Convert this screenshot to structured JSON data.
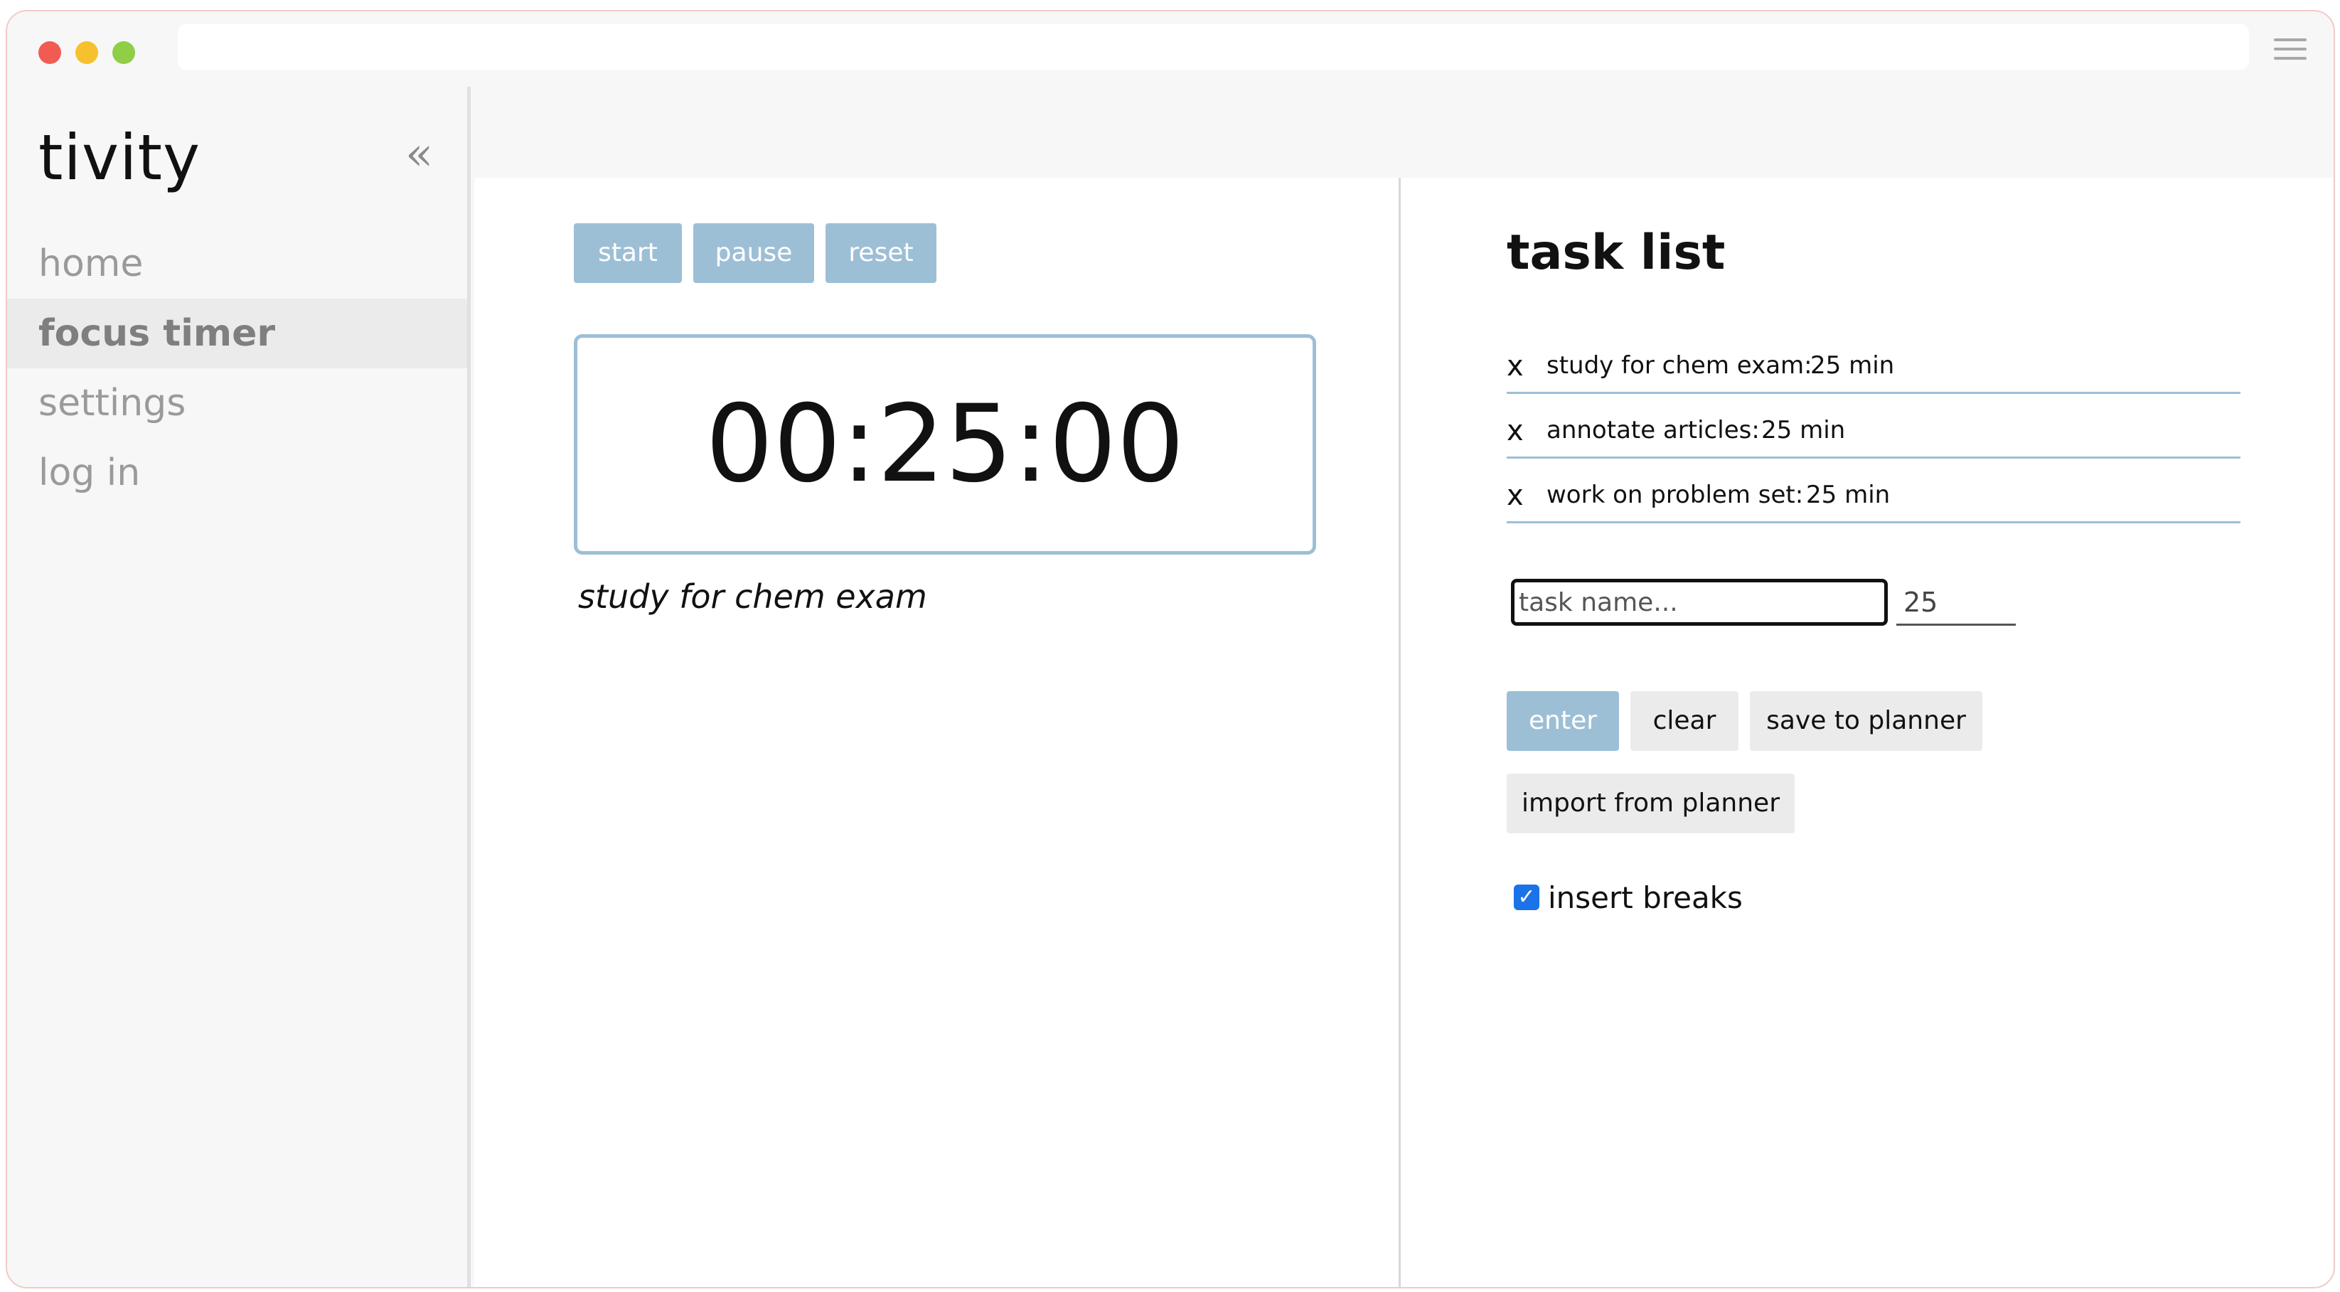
{
  "brand": {
    "title": "tivity",
    "collapse_symbol": "«"
  },
  "sidebar": {
    "items": [
      {
        "label": "home"
      },
      {
        "label": "focus timer",
        "active": true
      },
      {
        "label": "settings"
      },
      {
        "label": "log in"
      }
    ]
  },
  "timer": {
    "controls": {
      "start": "start",
      "pause": "pause",
      "reset": "reset"
    },
    "display": "00:25:00",
    "current_task": "study for chem exam"
  },
  "tasks": {
    "heading": "task list",
    "remove_symbol": "x",
    "items": [
      {
        "name": "study for chem exam:",
        "minutes": "25 min"
      },
      {
        "name": "annotate articles:",
        "minutes": "25 min"
      },
      {
        "name": "work on problem set:",
        "minutes": "25 min"
      }
    ],
    "form": {
      "name_placeholder": "task name...",
      "minutes_value": "25",
      "enter_label": "enter",
      "clear_label": "clear",
      "save_label": "save to planner",
      "import_label": "import from planner",
      "breaks_label": "insert breaks",
      "breaks_checked": true
    }
  },
  "colors": {
    "accent": "#9dbfd6",
    "checkbox": "#1a73e8"
  }
}
